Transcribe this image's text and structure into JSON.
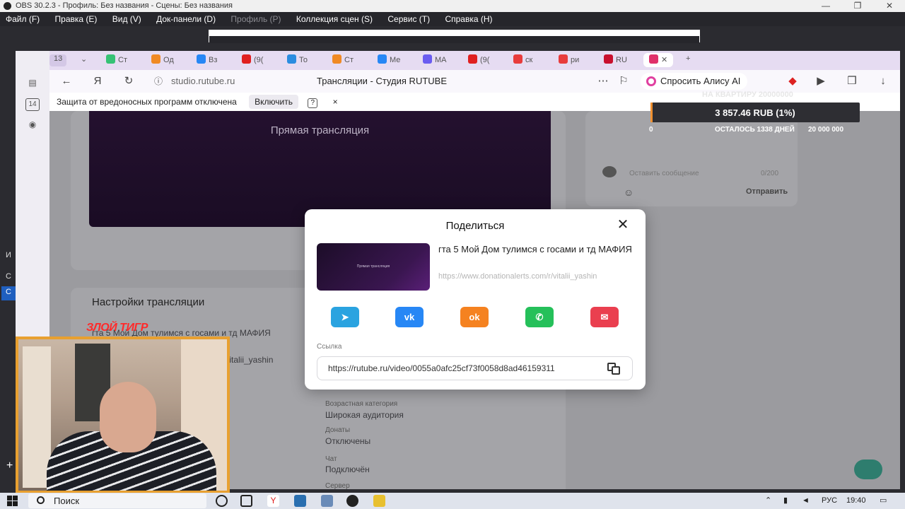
{
  "obs": {
    "title": "OBS 30.2.3 - Профиль: Без названия - Сцены: Без названия",
    "menu": [
      "Файл (F)",
      "Правка (E)",
      "Вид (V)",
      "Док-панели (D)",
      "Профиль (P)",
      "Коллекция сцен (S)",
      "Сервис (T)",
      "Справка (H)"
    ],
    "side_labels": [
      "И",
      "С",
      "С"
    ]
  },
  "browser": {
    "tab_count": "13",
    "tabs": [
      {
        "label": "Ст",
        "color": "#36c275"
      },
      {
        "label": "Од",
        "color": "#f08a24"
      },
      {
        "label": "Вз",
        "color": "#2787f5"
      },
      {
        "label": "(9(",
        "color": "#e02020"
      },
      {
        "label": "То",
        "color": "#2b8de0"
      },
      {
        "label": "Ст",
        "color": "#f08a24"
      },
      {
        "label": "Ме",
        "color": "#2787f5"
      },
      {
        "label": "МА",
        "color": "#6a5cf0"
      },
      {
        "label": "(9(",
        "color": "#e02020"
      },
      {
        "label": "ск",
        "color": "#e83c3c"
      },
      {
        "label": "ри",
        "color": "#e83c3c"
      },
      {
        "label": "RU",
        "color": "#c8102e"
      }
    ],
    "url": "studio.rutube.ru",
    "page_title": "Трансляции - Студия RUTUBE",
    "alice_label": "Спросить Алису AI",
    "sidebar_badge": "14",
    "infobar": {
      "text": "Защита от вредоносных программ отключена",
      "button": "Включить",
      "help": "?",
      "close": "×"
    }
  },
  "page": {
    "player_label": "Прямая трансляция",
    "settings_heading": "Настройки трансляции",
    "stream_title_partial": "гта 5 Мой Дом тулимся с госами и тд МАФИЯ",
    "link_partial": "/vitalii_yashin",
    "fields": [
      {
        "label": "Возрастная категория",
        "value": "Широкая аудитория"
      },
      {
        "label": "Донаты",
        "value": "Отключены"
      },
      {
        "label": "Чат",
        "value": "Подключён"
      }
    ],
    "more_label": "Сервер"
  },
  "widget": {
    "caption": "НА КВАРТИРУ 20000000",
    "amount": "3 857.46 RUB (1%)",
    "progress": 0.01,
    "min": "0",
    "remaining": "ОСТАЛОСЬ 1338 ДНЕЙ",
    "max": "20 000 000"
  },
  "chat": {
    "placeholder": "Оставить сообщение",
    "counter": "0/200",
    "send": "Отправить"
  },
  "dialog": {
    "title": "Поделиться",
    "close": "✕",
    "thumb_label": "Прямая трансляция",
    "video_title": "гта 5 Мой Дом тулимся с госами и тд МАФИЯ",
    "video_link": "https://www.donationalerts.com/r/vitalii_yashin",
    "share_targets": [
      {
        "name": "telegram",
        "color": "#2aa3e0",
        "glyph": "➤"
      },
      {
        "name": "vk",
        "color": "#2787f5",
        "glyph": "vk"
      },
      {
        "name": "ok",
        "color": "#f58220",
        "glyph": "ok"
      },
      {
        "name": "whatsapp",
        "color": "#25c05a",
        "glyph": "✆"
      },
      {
        "name": "email",
        "color": "#ea3f4f",
        "glyph": "✉"
      }
    ],
    "link_label": "Ссылка",
    "link_value": "https://rutube.ru/video/0055a0afc25cf73f0058d8ad46159311"
  },
  "webcam": {
    "overlay_name": "ЗЛОЙ ТИГР"
  },
  "taskbar": {
    "search": "Поиск",
    "lang": "РУС",
    "time": "19:40"
  }
}
